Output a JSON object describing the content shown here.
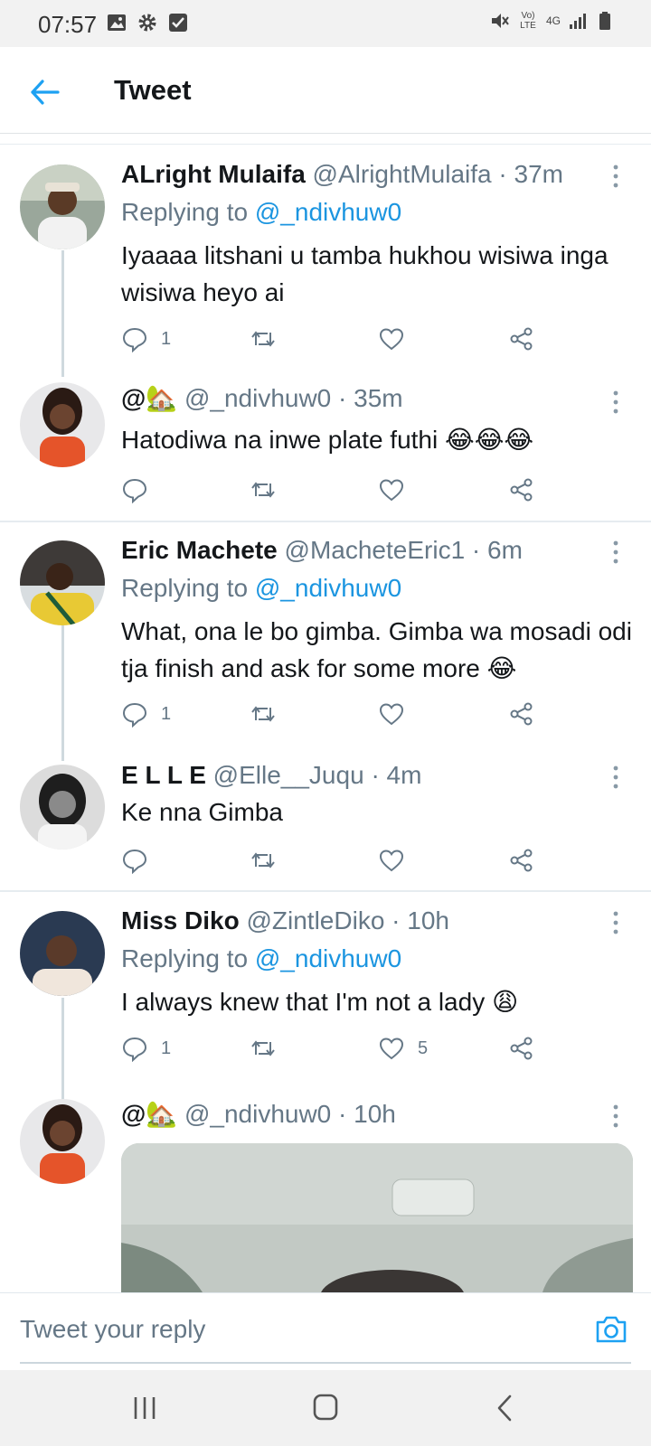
{
  "status_bar": {
    "time": "07:57",
    "icons": [
      "image-icon",
      "gear-icon",
      "check-icon",
      "mute-icon",
      "volte-icon",
      "4g-icon",
      "signal-icon",
      "battery-icon"
    ],
    "volte_label": "Vo) LTE",
    "network_label": "4G"
  },
  "header": {
    "title": "Tweet",
    "accent": "#1da1f2"
  },
  "tweets": [
    {
      "name": "ALright Mulaifa",
      "handle": "@AlrightMulaifa",
      "time": "· 37m",
      "replying_prefix": "Replying to",
      "replying_to": "@_ndivhuw0",
      "text": "Iyaaaa litshani u tamba hukhou wisiwa inga wisiwa heyo ai",
      "reply_count": "1",
      "like_count": ""
    },
    {
      "name": "@🏡",
      "handle": "@_ndivhuw0",
      "time": "· 35m",
      "text": "Hatodiwa na inwe plate futhi 😂😂😂",
      "reply_count": "",
      "like_count": ""
    },
    {
      "name": "Eric Machete",
      "handle": "@MacheteEric1",
      "time": "· 6m",
      "replying_prefix": "Replying to",
      "replying_to": "@_ndivhuw0",
      "text": "What, ona le bo gimba. Gimba wa mosadi odi tja finish and ask for some more 😂",
      "reply_count": "1",
      "like_count": ""
    },
    {
      "name": "E L L E",
      "handle": "@Elle__Juqu",
      "time": "· 4m",
      "text": "Ke nna Gimba",
      "reply_count": "",
      "like_count": ""
    },
    {
      "name": "Miss Diko",
      "handle": "@ZintleDiko",
      "time": "· 10h",
      "replying_prefix": "Replying to",
      "replying_to": "@_ndivhuw0",
      "text": "I always knew that I'm not a lady 😩",
      "reply_count": "1",
      "like_count": "5"
    },
    {
      "name": "@🏡",
      "handle": "@_ndivhuw0",
      "time": "· 10h"
    }
  ],
  "reply_bar": {
    "placeholder": "Tweet your reply"
  },
  "nav": {
    "buttons": [
      "recent-apps-icon",
      "home-icon",
      "back-icon"
    ]
  }
}
